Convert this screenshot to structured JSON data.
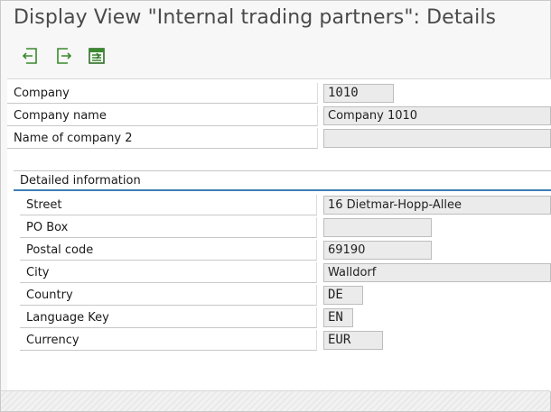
{
  "window": {
    "title": "Display View \"Internal trading partners\": Details"
  },
  "toolbar": {
    "buttons": [
      {
        "icon": "previous-entry-icon"
      },
      {
        "icon": "next-entry-icon"
      },
      {
        "icon": "variable-list-icon"
      }
    ]
  },
  "header_fields": [
    {
      "label": "Company",
      "value": "1010"
    },
    {
      "label": "Company name",
      "value": "Company 1010"
    },
    {
      "label": "Name of company 2",
      "value": ""
    }
  ],
  "detail_group": {
    "title": "Detailed information",
    "fields": [
      {
        "label": "Street",
        "value": "16 Dietmar-Hopp-Allee"
      },
      {
        "label": "PO Box",
        "value": ""
      },
      {
        "label": "Postal code",
        "value": "69190"
      },
      {
        "label": "City",
        "value": "Walldorf"
      },
      {
        "label": "Country",
        "value": "DE"
      },
      {
        "label": "Language Key",
        "value": "EN"
      },
      {
        "label": "Currency",
        "value": "EUR"
      }
    ]
  },
  "colors": {
    "accent": "#3f7fb5",
    "icon_green": "#3a8a2e",
    "field_bg": "#ebebeb"
  }
}
